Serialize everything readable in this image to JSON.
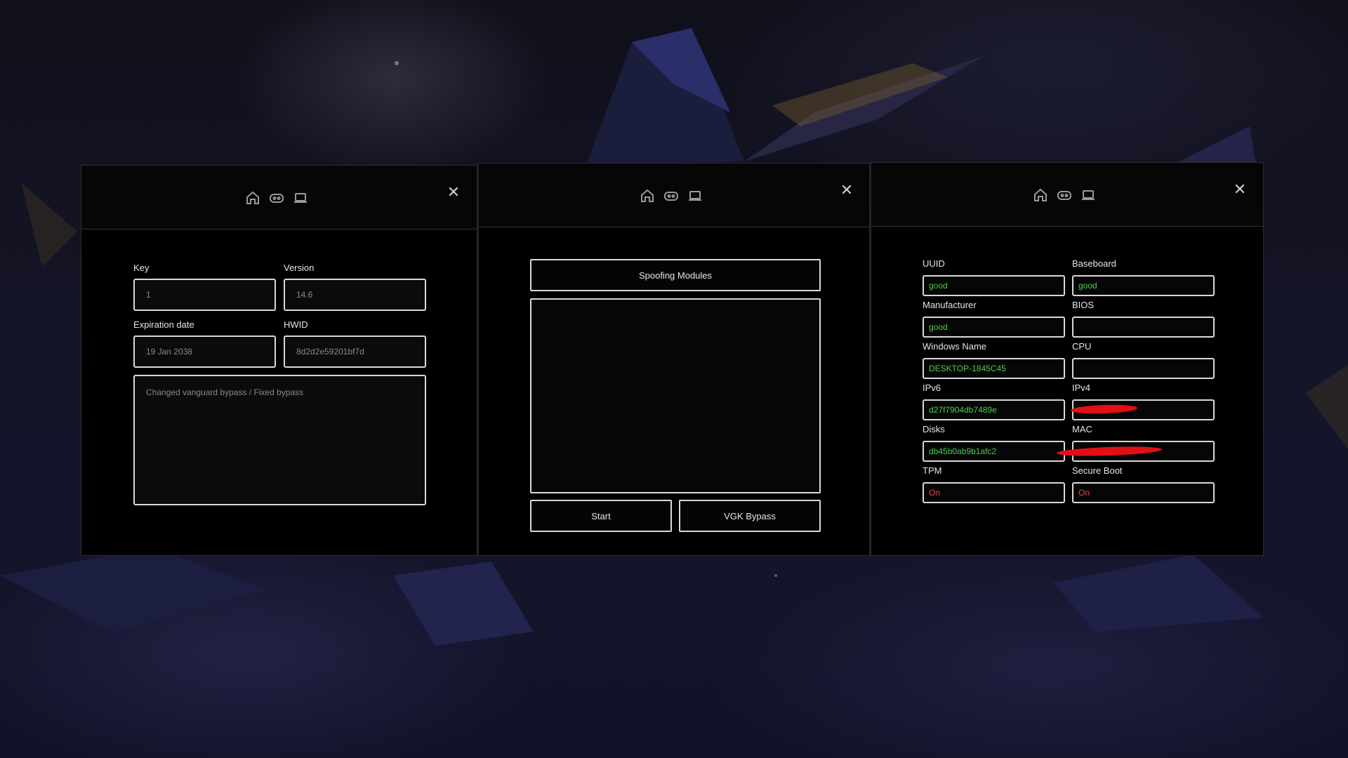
{
  "windows": {
    "nav_icons": [
      "home-icon",
      "gamepad-icon",
      "laptop-icon"
    ],
    "close_glyph": "✕"
  },
  "info_window": {
    "key_label": "Key",
    "key_value": "1",
    "version_label": "Version",
    "version_value": "14.6",
    "expiration_label": "Expiration date",
    "expiration_value": "19 Jan 2038",
    "hwid_label": "HWID",
    "hwid_value": "8d2d2e59201bf7d",
    "changelog": "Changed vanguard bypass / Fixed bypass"
  },
  "modules_window": {
    "header_button": "Spoofing Modules",
    "start_button": "Start",
    "vgk_button": "VGK Bypass"
  },
  "system_window": {
    "fields": [
      {
        "label": "UUID",
        "value": "good",
        "status": "good"
      },
      {
        "label": "Baseboard",
        "value": "good",
        "status": "good"
      },
      {
        "label": "Manufacturer",
        "value": "good",
        "status": "good"
      },
      {
        "label": "BIOS",
        "value": "",
        "status": "good"
      },
      {
        "label": "Windows Name",
        "value": "DESKTOP-1845C45",
        "status": "good"
      },
      {
        "label": "CPU",
        "value": "",
        "status": "good"
      },
      {
        "label": "IPv6",
        "value": "d27f7904db7489e",
        "status": "good"
      },
      {
        "label": "IPv4",
        "value": "",
        "status": "redacted"
      },
      {
        "label": "Disks",
        "value": "db45b0ab9b1afc2",
        "status": "good"
      },
      {
        "label": "MAC",
        "value": "",
        "status": "redacted"
      },
      {
        "label": "TPM",
        "value": "On",
        "status": "bad"
      },
      {
        "label": "Secure Boot",
        "value": "On",
        "status": "bad"
      }
    ]
  },
  "colors": {
    "good": "#4ccd4c",
    "bad": "#e24a4a",
    "redaction": "#e30f16",
    "window_bg": "#000000",
    "field_border": "#d9d9d9"
  }
}
